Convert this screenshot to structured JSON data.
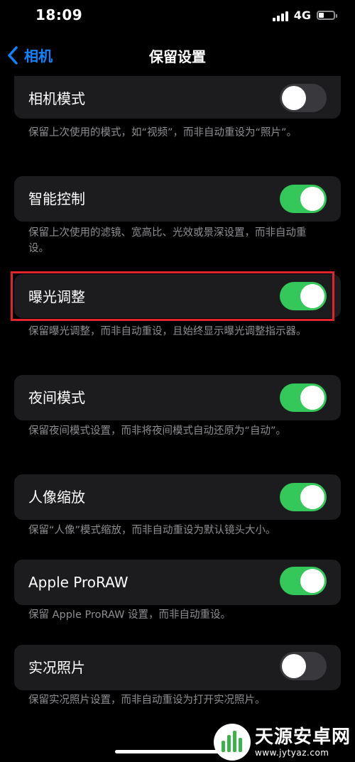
{
  "status_bar": {
    "time": "18:09",
    "network": "4G",
    "battery_level": 0.4
  },
  "nav": {
    "back_label": "相机",
    "title": "保留设置"
  },
  "settings": [
    {
      "label": "相机模式",
      "on": false,
      "footer": "保留上次使用的模式，如“视频”，而非自动重设为“照片”。"
    },
    {
      "label": "智能控制",
      "on": true,
      "footer": "保留上次使用的滤镜、宽高比、光效或景深设置，而非自动重设。"
    },
    {
      "label": "曝光调整",
      "on": true,
      "footer": "保留曝光调整，而非自动重设，且始终显示曝光调整指示器。"
    },
    {
      "label": "夜间模式",
      "on": true,
      "footer": "保留夜间模式设置，而非将夜间模式自动还原为“自动”。"
    },
    {
      "label": "人像缩放",
      "on": true,
      "footer": "保留“人像”模式缩放，而非自动重设为默认镜头大小。"
    },
    {
      "label": "Apple ProRAW",
      "on": true,
      "footer": "保留 Apple ProRAW 设置，而非自动重设。"
    },
    {
      "label": "实况照片",
      "on": false,
      "footer": "保留实况照片设置，而非自动重设为打开实况照片。"
    }
  ],
  "watermark": {
    "title": "天源安卓网",
    "url": "www.jytyaz.com"
  },
  "colors": {
    "accent": "#0a84ff",
    "toggle_on": "#34c759",
    "toggle_off": "#39393d",
    "highlight": "#e0262b"
  }
}
